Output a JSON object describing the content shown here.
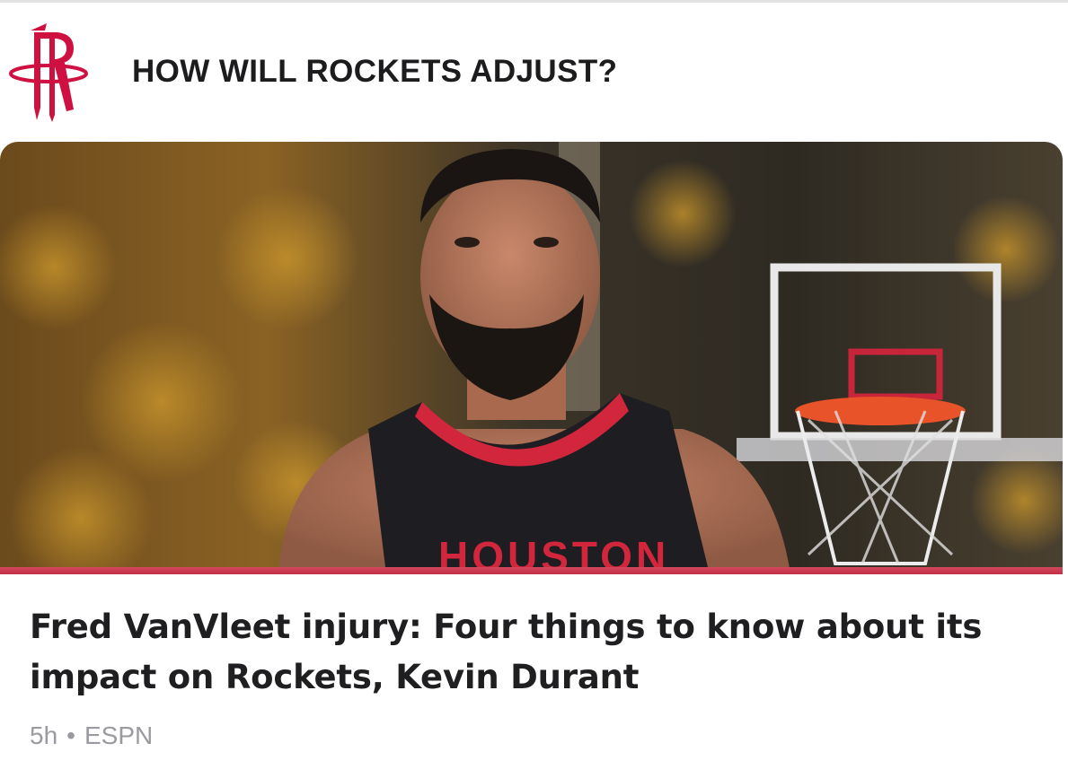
{
  "section": {
    "title": "HOW WILL ROCKETS ADJUST?",
    "logo_icon": "houston-rockets-logo-icon"
  },
  "article": {
    "image_icon": "player-photo-image",
    "headline": "Fred VanVleet injury: Four things to know about its impact on Rockets, Kevin Durant",
    "time_ago": "5h",
    "separator": "•",
    "source": "ESPN"
  },
  "colors": {
    "accent": "#ce1141",
    "title_text": "#1c1c1e",
    "meta_text": "#9a9aa0"
  }
}
